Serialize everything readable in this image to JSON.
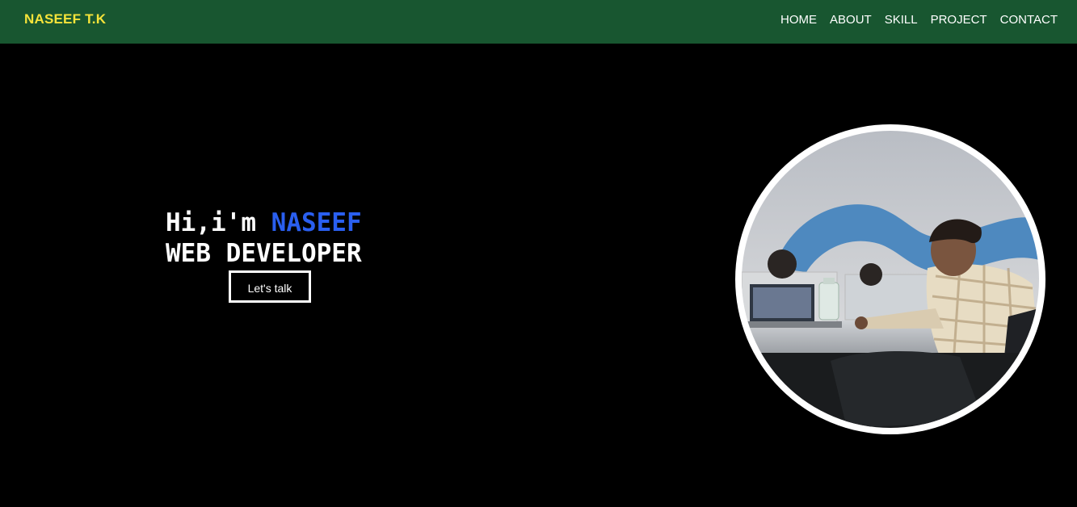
{
  "navbar": {
    "brand": "NASEEF T.K",
    "links": [
      "HOME",
      "ABOUT",
      "SKILL",
      "PROJECT",
      "CONTACT"
    ]
  },
  "hero": {
    "greeting": "Hi,i'm ",
    "name": "NASEEF",
    "role": "WEB DEVELOPER",
    "cta_label": "Let's talk"
  },
  "colors": {
    "navbar_bg": "#185630",
    "brand": "#f5e33a",
    "name_accent": "#2a5ff0",
    "background": "#000000"
  }
}
